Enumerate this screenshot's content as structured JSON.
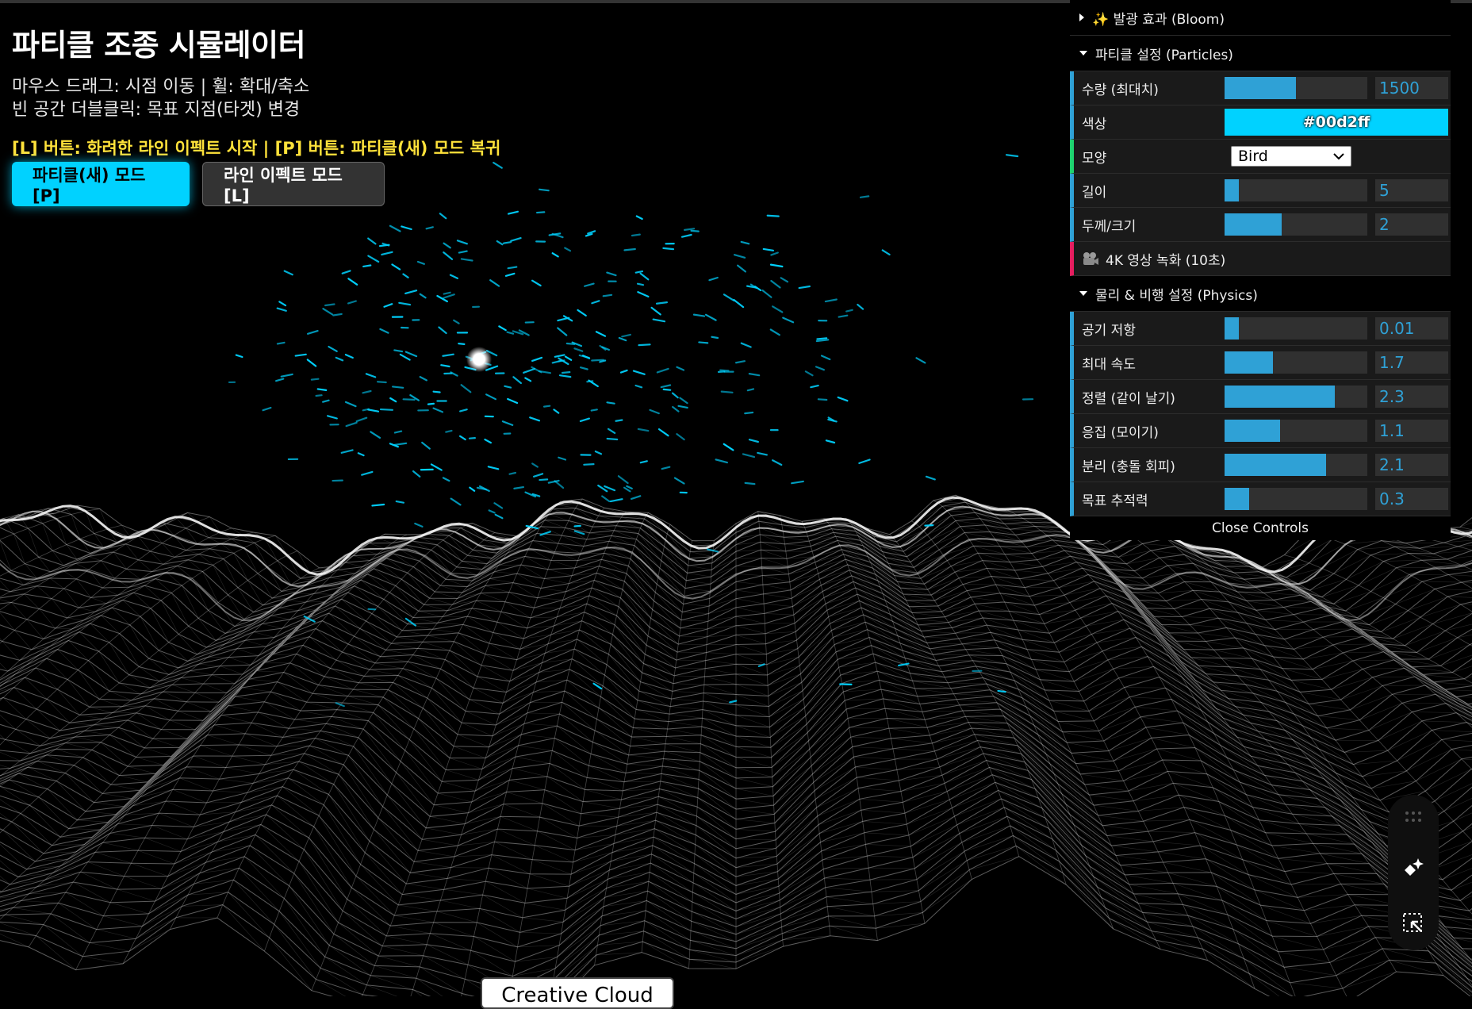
{
  "title": "파티클 조종 시뮬레이터",
  "help_line1": "마우스 드래그: 시점 이동 | 휠: 확대/축소",
  "help_line2": "빈 공간 더블클릭: 목표 지점(타겟) 변경",
  "hint": "[L] 버튼: 화려한 라인 이펙트 시작 | [P] 버튼: 파티클(새) 모드 복귀",
  "buttons": {
    "particle_mode": "파티클(새) 모드 [P]",
    "line_mode": "라인 이펙트 모드 [L]"
  },
  "gui": {
    "bloom_folder": "✨ 발광 효과 (Bloom)",
    "particles_folder": "파티클 설정 (Particles)",
    "count": {
      "label": "수량 (최대치)",
      "value": "1500",
      "fraction": 0.5
    },
    "color": {
      "label": "색상",
      "value": "#00d2ff"
    },
    "shape": {
      "label": "모양",
      "value": "Bird"
    },
    "length": {
      "label": "길이",
      "value": "5",
      "fraction": 0.1
    },
    "thickness": {
      "label": "두께/크기",
      "value": "2",
      "fraction": 0.4
    },
    "record": {
      "label": "4K 영상 녹화 (10초)",
      "icon": "camera-icon"
    },
    "physics_folder": "물리 & 비행 설정 (Physics)",
    "physics": [
      {
        "label": "공기 저항",
        "value": "0.01",
        "fraction": 0.1
      },
      {
        "label": "최대 속도",
        "value": "1.7",
        "fraction": 0.34
      },
      {
        "label": "정렬 (같이 날기)",
        "value": "2.3",
        "fraction": 0.77
      },
      {
        "label": "응집 (모이기)",
        "value": "1.1",
        "fraction": 0.39
      },
      {
        "label": "분리 (충돌 회피)",
        "value": "2.1",
        "fraction": 0.71
      },
      {
        "label": "목표 추적력",
        "value": "0.3",
        "fraction": 0.17
      }
    ],
    "close": "Close Controls"
  },
  "tools": [
    "grip-icon",
    "sparkle-icon",
    "select-icon"
  ],
  "cc_tab": "Creative Cloud",
  "colors": {
    "accent": "#00d2ff",
    "slider": "#2fa1d6",
    "hint": "#ffe23a"
  }
}
